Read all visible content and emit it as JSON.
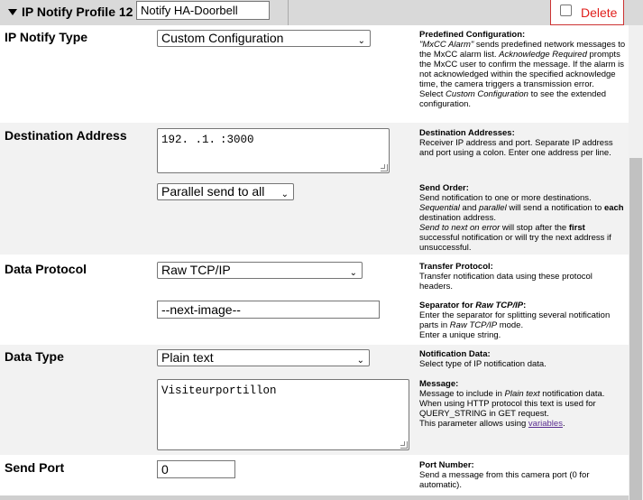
{
  "header": {
    "title": "IP Notify Profile 12",
    "profile_name": "Notify HA-Doorbell",
    "delete_label": "Delete"
  },
  "rows": {
    "type": {
      "label": "IP Notify Type",
      "select_value": "Custom Configuration",
      "help_title": "Predefined Configuration",
      "help_l1": "\"MxCC Alarm\"",
      "help_l1b": " sends predefined network messages to the MxCC alarm list. ",
      "help_l2": "Acknowledge Required",
      "help_l2b": " prompts the MxCC user to confirm the message. If the alarm is not acknowledged within the specified acknowledge time, the camera triggers a transmission error.",
      "help_l3": "Select ",
      "help_l3b": "Custom Configuration",
      "help_l3c": " to see the extended configuration."
    },
    "destination": {
      "label": "Destination Address",
      "address": "192.   .1.  :3000",
      "help_title": "Destination Addresses",
      "help_body": "Receiver IP address and port. Separate IP address and port using a colon. Enter one address per line.",
      "order_value": "Parallel send to all",
      "order_title": "Send Order",
      "order_l1": "Send notification to one or more destinations.",
      "order_l2a": "Sequential",
      "order_l2b": " and ",
      "order_l2c": "parallel",
      "order_l2d": " will send a notification to ",
      "order_l2e": "each",
      "order_l2f": " destination address.",
      "order_l3a": "Send to next on error",
      "order_l3b": " will stop after the ",
      "order_l3c": "first",
      "order_l3d": " successful notification or will try the next address if unsuccessful."
    },
    "protocol": {
      "label": "Data Protocol",
      "select_value": "Raw TCP/IP",
      "help_title": "Transfer Protocol",
      "help_body": "Transfer notification data using these protocol headers.",
      "separator_value": "--next-image--",
      "sep_title_a": "Separator for ",
      "sep_title_b": "Raw TCP/IP",
      "sep_body_a": "Enter the separator for splitting several notification parts in ",
      "sep_body_b": "Raw TCP/IP",
      "sep_body_c": " mode.",
      "sep_body_d": "Enter a unique string."
    },
    "datatype": {
      "label": "Data Type",
      "select_value": "Plain text",
      "help_title": "Notification Data",
      "help_body": "Select type of IP notification data.",
      "message_value": "Visiteurportillon",
      "msg_title": "Message",
      "msg_a": "Message to include in ",
      "msg_b": "Plain text",
      "msg_c": " notification data.",
      "msg_d": "When using HTTP protocol this text is used for QUERY_STRING in GET request.",
      "msg_e": "This parameter allows using ",
      "msg_link": "variables",
      "msg_f": "."
    },
    "port": {
      "label": "Send Port",
      "value": "0",
      "help_title": "Port Number",
      "help_body": "Send a message from this camera port (0 for automatic)."
    }
  }
}
